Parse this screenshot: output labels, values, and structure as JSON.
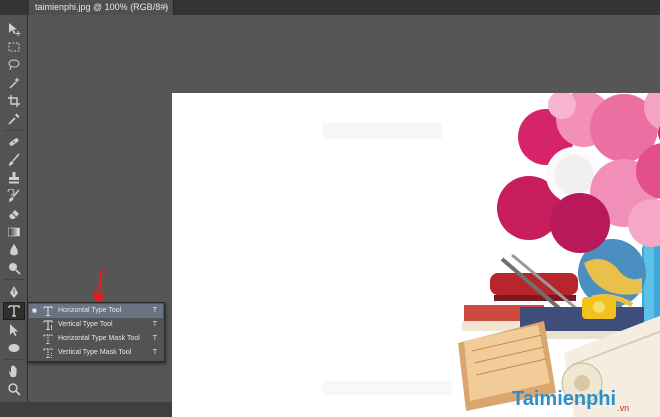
{
  "document": {
    "tab_title": "taimienphi.jpg @ 100% (RGB/8#)",
    "close_glyph": "×"
  },
  "toolbar": {
    "tools": [
      {
        "name": "move-tool-icon"
      },
      {
        "name": "marquee-tool-icon"
      },
      {
        "name": "lasso-tool-icon"
      },
      {
        "name": "magic-wand-tool-icon"
      },
      {
        "name": "crop-tool-icon"
      },
      {
        "name": "eyedropper-tool-icon"
      },
      {
        "name": "healing-brush-tool-icon"
      },
      {
        "name": "brush-tool-icon"
      },
      {
        "name": "clone-stamp-tool-icon"
      },
      {
        "name": "history-brush-tool-icon"
      },
      {
        "name": "eraser-tool-icon"
      },
      {
        "name": "gradient-tool-icon"
      },
      {
        "name": "blur-tool-icon"
      },
      {
        "name": "dodge-tool-icon"
      },
      {
        "name": "pen-tool-icon"
      },
      {
        "name": "type-tool-icon"
      },
      {
        "name": "path-selection-tool-icon"
      },
      {
        "name": "rectangle-tool-icon"
      },
      {
        "name": "ellipse-tool-icon"
      },
      {
        "name": "hand-tool-icon"
      },
      {
        "name": "zoom-tool-icon"
      }
    ]
  },
  "type_flyout": {
    "items": [
      {
        "label": "Horizontal Type Tool",
        "shortcut": "T",
        "selected": true,
        "bullet": "■"
      },
      {
        "label": "Vertical Type Tool",
        "shortcut": "T",
        "selected": false,
        "bullet": ""
      },
      {
        "label": "Horizontal Type Mask Tool",
        "shortcut": "T",
        "selected": false,
        "bullet": ""
      },
      {
        "label": "Vertical Type Mask Tool",
        "shortcut": "T",
        "selected": false,
        "bullet": ""
      }
    ]
  },
  "watermark": {
    "brand": "Taimienphi",
    "suffix": ".vn"
  },
  "colors": {
    "accent_arrow": "#e02020",
    "menu_highlight": "#6a7383",
    "watermark_blue": "#2d8fc9",
    "watermark_red": "#c53030"
  }
}
